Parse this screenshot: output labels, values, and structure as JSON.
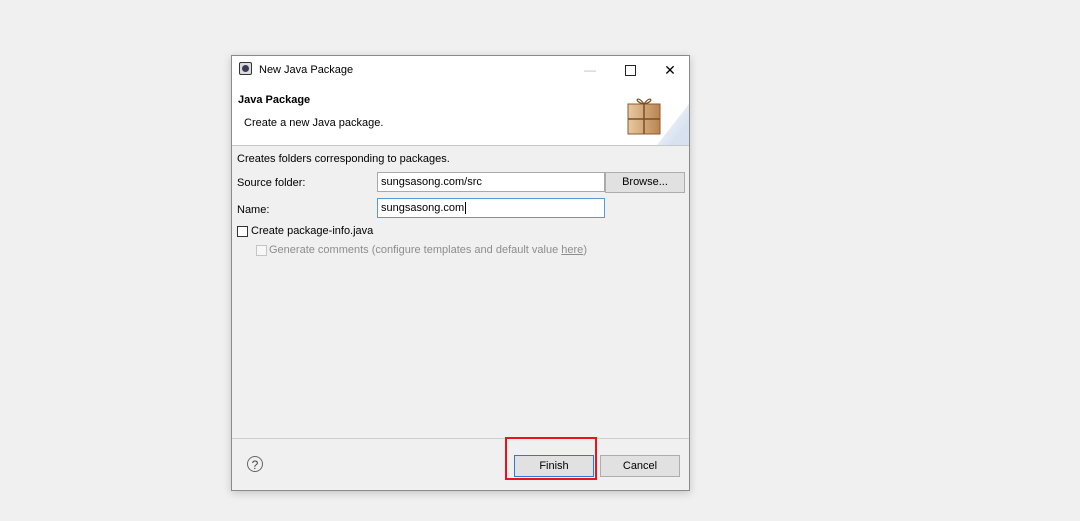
{
  "window": {
    "title": "New Java Package",
    "minimize_glyph": "—",
    "close_glyph": "✕"
  },
  "header": {
    "title": "Java Package",
    "description": "Create a new Java package."
  },
  "form": {
    "intro": "Creates folders corresponding to packages.",
    "source_folder_label": "Source folder:",
    "source_folder_value": "sungsasong.com/src",
    "browse_label": "Browse...",
    "name_label": "Name:",
    "name_value": "sungsasong.com",
    "create_package_info_label": "Create package-info.java",
    "create_package_info_checked": false,
    "generate_comments_label": "Generate comments (configure templates and default value ",
    "generate_comments_link": "here",
    "generate_comments_suffix": ")",
    "generate_comments_checked": false,
    "generate_comments_enabled": false
  },
  "footer": {
    "help_glyph": "?",
    "finish_label": "Finish",
    "cancel_label": "Cancel"
  },
  "colors": {
    "highlight": "#e8141c",
    "default_button_border": "#2f78d3"
  }
}
